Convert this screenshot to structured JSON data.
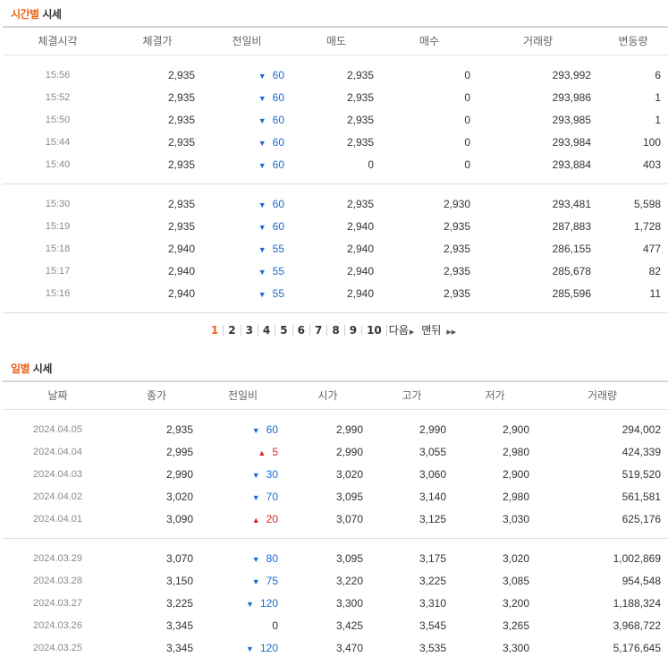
{
  "time_section": {
    "title_accent": "시간별",
    "title_rest": "시세",
    "headers": [
      "체결시각",
      "체결가",
      "전일비",
      "매도",
      "매수",
      "거래량",
      "변동량"
    ],
    "group1": [
      {
        "time": "15:56",
        "price": "2,935",
        "dir": "down",
        "change": "60",
        "ask": "2,935",
        "bid": "0",
        "volume": "293,992",
        "delta": "6"
      },
      {
        "time": "15:52",
        "price": "2,935",
        "dir": "down",
        "change": "60",
        "ask": "2,935",
        "bid": "0",
        "volume": "293,986",
        "delta": "1"
      },
      {
        "time": "15:50",
        "price": "2,935",
        "dir": "down",
        "change": "60",
        "ask": "2,935",
        "bid": "0",
        "volume": "293,985",
        "delta": "1"
      },
      {
        "time": "15:44",
        "price": "2,935",
        "dir": "down",
        "change": "60",
        "ask": "2,935",
        "bid": "0",
        "volume": "293,984",
        "delta": "100"
      },
      {
        "time": "15:40",
        "price": "2,935",
        "dir": "down",
        "change": "60",
        "ask": "0",
        "bid": "0",
        "volume": "293,884",
        "delta": "403"
      }
    ],
    "group2": [
      {
        "time": "15:30",
        "price": "2,935",
        "dir": "down",
        "change": "60",
        "ask": "2,935",
        "bid": "2,930",
        "volume": "293,481",
        "delta": "5,598"
      },
      {
        "time": "15:19",
        "price": "2,935",
        "dir": "down",
        "change": "60",
        "ask": "2,940",
        "bid": "2,935",
        "volume": "287,883",
        "delta": "1,728"
      },
      {
        "time": "15:18",
        "price": "2,940",
        "dir": "down",
        "change": "55",
        "ask": "2,940",
        "bid": "2,935",
        "volume": "286,155",
        "delta": "477"
      },
      {
        "time": "15:17",
        "price": "2,940",
        "dir": "down",
        "change": "55",
        "ask": "2,940",
        "bid": "2,935",
        "volume": "285,678",
        "delta": "82"
      },
      {
        "time": "15:16",
        "price": "2,940",
        "dir": "down",
        "change": "55",
        "ask": "2,940",
        "bid": "2,935",
        "volume": "285,596",
        "delta": "11"
      }
    ]
  },
  "pagination": {
    "pages": [
      "1",
      "2",
      "3",
      "4",
      "5",
      "6",
      "7",
      "8",
      "9",
      "10"
    ],
    "current": "1",
    "next_label": "다음",
    "last_label": "맨뒤"
  },
  "daily_section": {
    "title_accent": "일별",
    "title_rest": "시세",
    "headers": [
      "날짜",
      "종가",
      "전일비",
      "시가",
      "고가",
      "저가",
      "거래량"
    ],
    "group1": [
      {
        "date": "2024.04.05",
        "close": "2,935",
        "dir": "down",
        "change": "60",
        "open": "2,990",
        "high": "2,990",
        "low": "2,900",
        "volume": "294,002"
      },
      {
        "date": "2024.04.04",
        "close": "2,995",
        "dir": "up",
        "change": "5",
        "open": "2,990",
        "high": "3,055",
        "low": "2,980",
        "volume": "424,339"
      },
      {
        "date": "2024.04.03",
        "close": "2,990",
        "dir": "down",
        "change": "30",
        "open": "3,020",
        "high": "3,060",
        "low": "2,900",
        "volume": "519,520"
      },
      {
        "date": "2024.04.02",
        "close": "3,020",
        "dir": "down",
        "change": "70",
        "open": "3,095",
        "high": "3,140",
        "low": "2,980",
        "volume": "561,581"
      },
      {
        "date": "2024.04.01",
        "close": "3,090",
        "dir": "up",
        "change": "20",
        "open": "3,070",
        "high": "3,125",
        "low": "3,030",
        "volume": "625,176"
      }
    ],
    "group2": [
      {
        "date": "2024.03.29",
        "close": "3,070",
        "dir": "down",
        "change": "80",
        "open": "3,095",
        "high": "3,175",
        "low": "3,020",
        "volume": "1,002,869"
      },
      {
        "date": "2024.03.28",
        "close": "3,150",
        "dir": "down",
        "change": "75",
        "open": "3,220",
        "high": "3,225",
        "low": "3,085",
        "volume": "954,548"
      },
      {
        "date": "2024.03.27",
        "close": "3,225",
        "dir": "down",
        "change": "120",
        "open": "3,300",
        "high": "3,310",
        "low": "3,200",
        "volume": "1,188,324"
      },
      {
        "date": "2024.03.26",
        "close": "3,345",
        "dir": "none",
        "change": "0",
        "open": "3,425",
        "high": "3,545",
        "low": "3,265",
        "volume": "3,968,722"
      },
      {
        "date": "2024.03.25",
        "close": "3,345",
        "dir": "down",
        "change": "120",
        "open": "3,470",
        "high": "3,535",
        "low": "3,300",
        "volume": "5,176,645"
      }
    ]
  },
  "colors": {
    "accent": "#e8641b",
    "down": "#1a6ad1",
    "up": "#d8222a"
  }
}
